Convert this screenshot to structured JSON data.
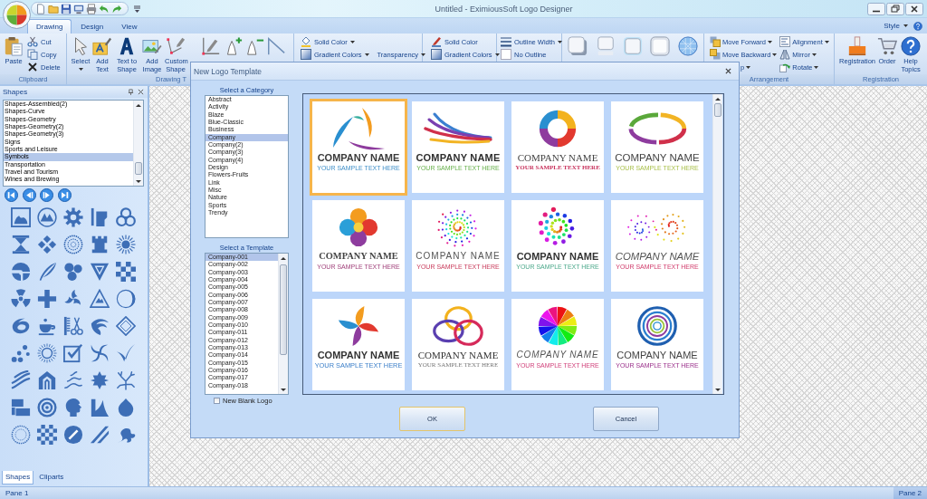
{
  "title_bar": {
    "title": "Untitled - EximiousSoft Logo Designer"
  },
  "ribbon": {
    "tabs": [
      {
        "label": "Drawing",
        "selected": true
      },
      {
        "label": "Design",
        "selected": false
      },
      {
        "label": "View",
        "selected": false
      }
    ],
    "style_menu": "Style",
    "groups": [
      {
        "label": "Clipboard",
        "items": [
          {
            "kind": "large",
            "label": "Paste",
            "dropdown": false
          },
          {
            "kind": "stack",
            "entries": [
              {
                "label": "Cut",
                "dropdown": false
              },
              {
                "label": "Copy",
                "dropdown": false
              },
              {
                "label": "Delete",
                "dropdown": false
              }
            ]
          }
        ]
      },
      {
        "label": "Drawing T",
        "items": [
          {
            "kind": "large",
            "label": "Select",
            "dropdown": true
          },
          {
            "kind": "large",
            "label": "Add Text",
            "dropdown": false
          },
          {
            "kind": "large",
            "label": "Text to Shape",
            "dropdown": false
          },
          {
            "kind": "large",
            "label": "Add Image",
            "dropdown": false
          },
          {
            "kind": "large",
            "label": "Custom Shape",
            "dropdown": false
          },
          {
            "kind": "icon"
          },
          {
            "kind": "icon"
          },
          {
            "kind": "icon"
          },
          {
            "kind": "icon"
          }
        ]
      },
      {
        "items": [
          {
            "kind": "stack",
            "entries": [
              {
                "label": "Solid Color",
                "dropdown": true
              },
              {
                "label": "Gradient Colors",
                "dropdown": true
              }
            ]
          },
          {
            "kind": "stack",
            "entries": [
              {
                "label": "Transparency",
                "dropdown": true
              }
            ]
          }
        ]
      },
      {
        "items": [
          {
            "kind": "stack",
            "entries": [
              {
                "label": "Solid Color",
                "dropdown": false
              },
              {
                "label": "Gradient Colors",
                "dropdown": true
              }
            ]
          }
        ]
      },
      {
        "items": [
          {
            "kind": "stack",
            "entries": [
              {
                "label": "Outline Width",
                "dropdown": true
              },
              {
                "label": "No Outline",
                "dropdown": false
              }
            ]
          }
        ]
      },
      {
        "items": [
          {
            "kind": "icon"
          },
          {
            "kind": "icon"
          },
          {
            "kind": "icon"
          },
          {
            "kind": "icon"
          },
          {
            "kind": "icon"
          }
        ]
      },
      {
        "label": "Arrangement",
        "items": [
          {
            "kind": "stack",
            "entries": [
              {
                "label": "Move Forward",
                "dropdown": true
              },
              {
                "label": "Move Backward",
                "dropdown": true
              },
              {
                "label": "p",
                "dropdown": true
              }
            ]
          },
          {
            "kind": "stack",
            "entries": [
              {
                "label": "Alignment",
                "dropdown": true
              },
              {
                "label": "Mirror",
                "dropdown": true
              },
              {
                "label": "Rotate",
                "dropdown": true
              }
            ]
          }
        ]
      },
      {
        "label": "Registration",
        "items": [
          {
            "kind": "large",
            "label": "Registration",
            "dropdown": false
          },
          {
            "kind": "large",
            "label": "Order",
            "dropdown": false
          },
          {
            "kind": "large",
            "label": "Help Topics",
            "dropdown": false
          }
        ]
      }
    ]
  },
  "shapes_panel": {
    "title": "Shapes",
    "categories": [
      {
        "label": "Shapes-Assembled(2)",
        "selected": false
      },
      {
        "label": "Shapes-Curve",
        "selected": false
      },
      {
        "label": "Shapes-Geometry",
        "selected": false
      },
      {
        "label": "Shapes-Geometry(2)",
        "selected": false
      },
      {
        "label": "Shapes-Geometry(3)",
        "selected": false
      },
      {
        "label": "Signs",
        "selected": false
      },
      {
        "label": "Sports and Leisure",
        "selected": false
      },
      {
        "label": "Symbols",
        "selected": true
      },
      {
        "label": "Transportation",
        "selected": false
      },
      {
        "label": "Travel and Tourism",
        "selected": false
      },
      {
        "label": "Wines and Brewing",
        "selected": false
      }
    ],
    "tabs": [
      {
        "label": "Shapes",
        "selected": true
      },
      {
        "label": "Cliparts",
        "selected": false
      }
    ]
  },
  "dialog": {
    "title": "New Logo Template",
    "category_label": "Select a Category",
    "categories": [
      {
        "label": "Abstract",
        "selected": false
      },
      {
        "label": "Activity",
        "selected": false
      },
      {
        "label": "Blaze",
        "selected": false
      },
      {
        "label": "Blue-Classic",
        "selected": false
      },
      {
        "label": "Business",
        "selected": false
      },
      {
        "label": "Company",
        "selected": true
      },
      {
        "label": "Company(2)",
        "selected": false
      },
      {
        "label": "Company(3)",
        "selected": false
      },
      {
        "label": "Company(4)",
        "selected": false
      },
      {
        "label": "Design",
        "selected": false
      },
      {
        "label": "Flowers-Fruits",
        "selected": false
      },
      {
        "label": "Link",
        "selected": false
      },
      {
        "label": "Misc",
        "selected": false
      },
      {
        "label": "Nature",
        "selected": false
      },
      {
        "label": "Sports",
        "selected": false
      },
      {
        "label": "Trendy",
        "selected": false
      }
    ],
    "template_label": "Select a Template",
    "templates": [
      {
        "label": "Company-001",
        "selected": true
      },
      {
        "label": "Company-002",
        "selected": false
      },
      {
        "label": "Company-003",
        "selected": false
      },
      {
        "label": "Company-004",
        "selected": false
      },
      {
        "label": "Company-005",
        "selected": false
      },
      {
        "label": "Company-006",
        "selected": false
      },
      {
        "label": "Company-007",
        "selected": false
      },
      {
        "label": "Company-008",
        "selected": false
      },
      {
        "label": "Company-009",
        "selected": false
      },
      {
        "label": "Company-010",
        "selected": false
      },
      {
        "label": "Company-011",
        "selected": false
      },
      {
        "label": "Company-012",
        "selected": false
      },
      {
        "label": "Company-013",
        "selected": false
      },
      {
        "label": "Company-014",
        "selected": false
      },
      {
        "label": "Company-015",
        "selected": false
      },
      {
        "label": "Company-016",
        "selected": false
      },
      {
        "label": "Company-017",
        "selected": false
      },
      {
        "label": "Company-018",
        "selected": false
      }
    ],
    "blank_logo": {
      "label": "New Blank Logo",
      "checked": false
    },
    "gallery": [
      {
        "name": "COMPANY NAME",
        "tagline": "YOUR SAMPLE TEXT HERE",
        "selected": true
      },
      {
        "name": "COMPANY NAME",
        "tagline": "YOUR SAMPLE TEXT HERE",
        "selected": false
      },
      {
        "name": "COMPANY NAME",
        "tagline": "YOUR SAMPLE TEXT HERE",
        "selected": false
      },
      {
        "name": "COMPANY NAME",
        "tagline": "YOUR SAMPLE TEXT HERE",
        "selected": false
      },
      {
        "name": "COMPANY NAME",
        "tagline": "YOUR SAMPLE TEXT HERE",
        "selected": false
      },
      {
        "name": "COMPANY NAME",
        "tagline": "YOUR SAMPLE TEXT HERE",
        "selected": false
      },
      {
        "name": "COMPANY NAME",
        "tagline": "YOUR SAMPLE TEXT HERE",
        "selected": false
      },
      {
        "name": "COMPANY NAME",
        "tagline": "YOUR SAMPLE TEXT HERE",
        "selected": false
      },
      {
        "name": "COMPANY NAME",
        "tagline": "YOUR SAMPLE TEXT HERE",
        "selected": false
      },
      {
        "name": "COMPANY NAME",
        "tagline": "YOUR SAMPLE TEXT HERE",
        "selected": false
      },
      {
        "name": "COMPANY NAME",
        "tagline": "YOUR SAMPLE TEXT HERE",
        "selected": false
      },
      {
        "name": "COMPANY NAME",
        "tagline": "YOUR SAMPLE TEXT HERE",
        "selected": false
      }
    ],
    "buttons": [
      {
        "label": "OK",
        "default": true
      },
      {
        "label": "Cancel",
        "default": false
      }
    ]
  },
  "status_bar": {
    "left": "Pane 1",
    "right": "Pane 2"
  }
}
